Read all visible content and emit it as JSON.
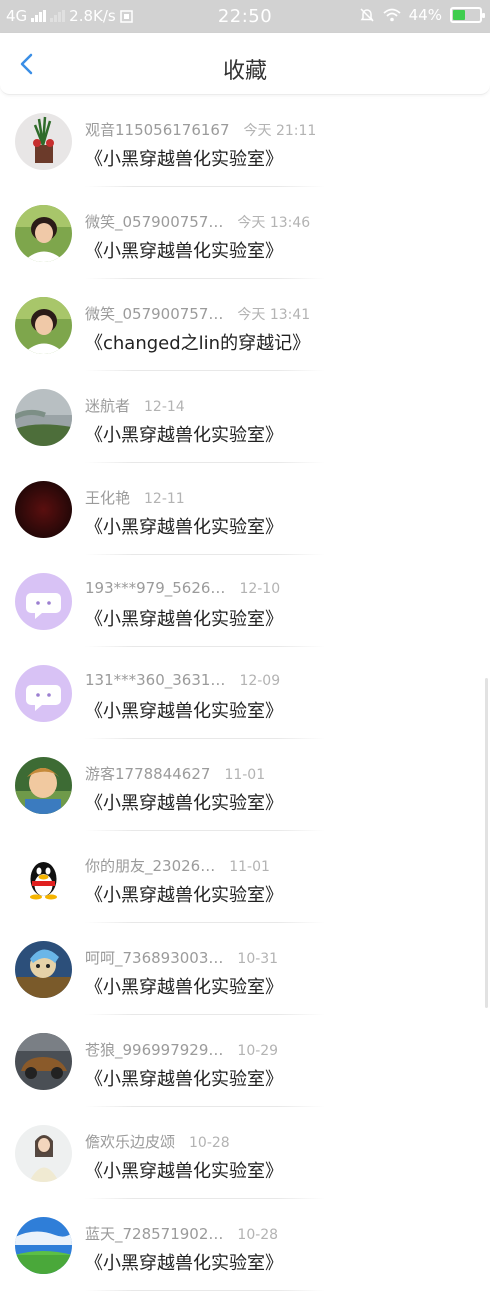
{
  "status_bar": {
    "network": "4G",
    "speed": "2.8K/s",
    "time": "22:50",
    "battery": "44%",
    "battery_level": 0.44,
    "battery_color": "#3fcd4e"
  },
  "header": {
    "title": "收藏",
    "back_icon": "chevron-left-icon",
    "accent_color": "#3a8ee6"
  },
  "favorites": [
    {
      "user": "观音115056176167",
      "time": "今天 21:11",
      "title": "《小黑穿越兽化实验室》",
      "avatar": "flower-photo"
    },
    {
      "user": "微笑_057900757…",
      "time": "今天 13:46",
      "title": "《小黑穿越兽化实验室》",
      "avatar": "woman-photo"
    },
    {
      "user": "微笑_057900757…",
      "time": "今天 13:41",
      "title": "《changed之lin的穿越记》",
      "avatar": "woman-photo"
    },
    {
      "user": "迷航者",
      "time": "12-14",
      "title": "《小黑穿越兽化实验室》",
      "avatar": "lake-photo"
    },
    {
      "user": "王化艳",
      "time": "12-11",
      "title": "《小黑穿越兽化实验室》",
      "avatar": "dark-red-photo"
    },
    {
      "user": "193***979_5626…",
      "time": "12-10",
      "title": "《小黑穿越兽化实验室》",
      "avatar": "chat-bubble-default"
    },
    {
      "user": "131***360_3631…",
      "time": "12-09",
      "title": "《小黑穿越兽化实验室》",
      "avatar": "chat-bubble-default"
    },
    {
      "user": "游客1778844627",
      "time": "11-01",
      "title": "《小黑穿越兽化实验室》",
      "avatar": "child-photo"
    },
    {
      "user": "你的朋友_23026…",
      "time": "11-01",
      "title": "《小黑穿越兽化实验室》",
      "avatar": "qq-penguin"
    },
    {
      "user": "呵呵_736893003…",
      "time": "10-31",
      "title": "《小黑穿越兽化实验室》",
      "avatar": "cartoon-character"
    },
    {
      "user": "苍狼_996997929…",
      "time": "10-29",
      "title": "《小黑穿越兽化实验室》",
      "avatar": "car-photo"
    },
    {
      "user": "儋欢乐边皮颂",
      "time": "10-28",
      "title": "《小黑穿越兽化实验室》",
      "avatar": "girl-photo"
    },
    {
      "user": "蓝天_728571902…",
      "time": "10-28",
      "title": "《小黑穿越兽化实验室》",
      "avatar": "blue-sky-photo"
    }
  ]
}
